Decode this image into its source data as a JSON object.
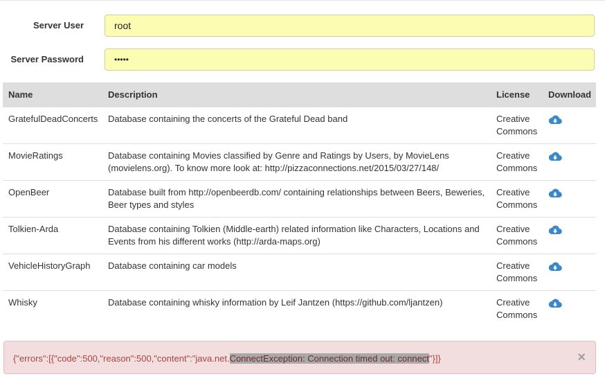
{
  "form": {
    "user_label": "Server User",
    "user_value": "root",
    "password_label": "Server Password",
    "password_value": "•••••"
  },
  "table": {
    "headers": {
      "name": "Name",
      "description": "Description",
      "license": "License",
      "download": "Download"
    },
    "rows": [
      {
        "name": "GratefulDeadConcerts",
        "description": "Database containing the concerts of the Grateful Dead band",
        "license_line1": "Creative",
        "license_line2": "Commons"
      },
      {
        "name": "MovieRatings",
        "description": "Database containing Movies classified by Genre and Ratings by Users, by MovieLens (movielens.org). To know more look at: http://pizzaconnections.net/2015/03/27/148/",
        "license_line1": "Creative",
        "license_line2": "Commons"
      },
      {
        "name": "OpenBeer",
        "description": "Database built from http://openbeerdb.com/ containing relationships between Beers, Beweries, Beer types and styles",
        "license_line1": "Creative",
        "license_line2": "Commons"
      },
      {
        "name": "Tolkien-Arda",
        "description": "Database containing Tolkien (Middle-earth) related information like Characters, Locations and Events from his different works (http://arda-maps.org)",
        "license_line1": "Creative",
        "license_line2": "Commons"
      },
      {
        "name": "VehicleHistoryGraph",
        "description": "Database containing car models",
        "license_line1": "Creative",
        "license_line2": "Commons"
      },
      {
        "name": "Whisky",
        "description": "Database containing whisky information by Leif Jantzen (https://github.com/ljantzen)",
        "license_line1": "Creative",
        "license_line2": "Commons"
      }
    ],
    "download_icon": "cloud-download-icon",
    "icon_color": "#3a87c9"
  },
  "alert": {
    "text_before": "{\"errors\":[{\"code\":500,\"reason\":500,\"content\":\"java.net.",
    "text_highlight": "ConnectException: Connection timed out: connect",
    "text_after": "\"}]}",
    "close_symbol": "×",
    "bg_color": "#f2dede",
    "text_color": "#a94442"
  }
}
